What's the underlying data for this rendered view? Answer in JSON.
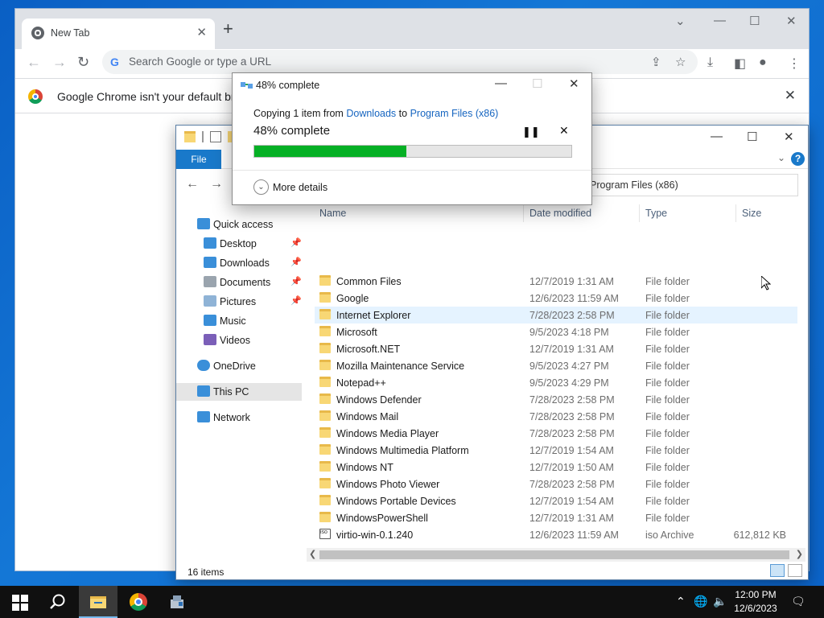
{
  "chrome": {
    "tab_title": "New Tab",
    "tab_close": "✕",
    "new_tab": "+",
    "omnibox_placeholder": "Search Google or type a URL",
    "infobar_text": "Google Chrome isn't your default brow",
    "infobar_close": "✕"
  },
  "copy_dialog": {
    "title": "48% complete",
    "copying_prefix": "Copying 1 item from",
    "source": "Downloads",
    "to_word": "to",
    "destination": "Program Files (x86)",
    "percent_label": "48% complete",
    "progress": 0.48,
    "progress_color": "#06b025",
    "more_details": "More details"
  },
  "explorer": {
    "ribbon_file": "File",
    "address_path": "Program Files (x86)",
    "nav": [
      {
        "label": "Quick access",
        "icon": "star-icon"
      },
      {
        "label": "Desktop",
        "icon": "desktop-icon",
        "pinned": true
      },
      {
        "label": "Downloads",
        "icon": "download-icon",
        "pinned": true
      },
      {
        "label": "Documents",
        "icon": "documents-icon",
        "pinned": true
      },
      {
        "label": "Pictures",
        "icon": "pictures-icon",
        "pinned": true
      },
      {
        "label": "Music",
        "icon": "music-icon"
      },
      {
        "label": "Videos",
        "icon": "videos-icon"
      },
      {
        "label": "OneDrive",
        "icon": "cloud-icon"
      },
      {
        "label": "This PC",
        "icon": "computer-icon",
        "selected": true
      },
      {
        "label": "Network",
        "icon": "network-icon"
      }
    ],
    "columns": {
      "name": "Name",
      "date": "Date modified",
      "type": "Type",
      "size": "Size"
    },
    "files": [
      {
        "name": "Common Files",
        "date": "12/7/2019 1:31 AM",
        "type": "File folder",
        "size": ""
      },
      {
        "name": "Google",
        "date": "12/6/2023 11:59 AM",
        "type": "File folder",
        "size": ""
      },
      {
        "name": "Internet Explorer",
        "date": "7/28/2023 2:58 PM",
        "type": "File folder",
        "size": ""
      },
      {
        "name": "Microsoft",
        "date": "9/5/2023 4:18 PM",
        "type": "File folder",
        "size": ""
      },
      {
        "name": "Microsoft.NET",
        "date": "12/7/2019 1:31 AM",
        "type": "File folder",
        "size": ""
      },
      {
        "name": "Mozilla Maintenance Service",
        "date": "9/5/2023 4:27 PM",
        "type": "File folder",
        "size": ""
      },
      {
        "name": "Notepad++",
        "date": "9/5/2023 4:29 PM",
        "type": "File folder",
        "size": ""
      },
      {
        "name": "Windows Defender",
        "date": "7/28/2023 2:58 PM",
        "type": "File folder",
        "size": ""
      },
      {
        "name": "Windows Mail",
        "date": "7/28/2023 2:58 PM",
        "type": "File folder",
        "size": ""
      },
      {
        "name": "Windows Media Player",
        "date": "7/28/2023 2:58 PM",
        "type": "File folder",
        "size": ""
      },
      {
        "name": "Windows Multimedia Platform",
        "date": "12/7/2019 1:54 AM",
        "type": "File folder",
        "size": ""
      },
      {
        "name": "Windows NT",
        "date": "12/7/2019 1:50 AM",
        "type": "File folder",
        "size": ""
      },
      {
        "name": "Windows Photo Viewer",
        "date": "7/28/2023 2:58 PM",
        "type": "File folder",
        "size": ""
      },
      {
        "name": "Windows Portable Devices",
        "date": "12/7/2019 1:54 AM",
        "type": "File folder",
        "size": ""
      },
      {
        "name": "WindowsPowerShell",
        "date": "12/7/2019 1:31 AM",
        "type": "File folder",
        "size": ""
      },
      {
        "name": "virtio-win-0.1.240",
        "date": "12/6/2023 11:59 AM",
        "type": "iso Archive",
        "size": "612,812 KB"
      }
    ],
    "hover_row": "Internet Explorer",
    "status_count": "16 items"
  },
  "taskbar": {
    "time": "12:00 PM",
    "date": "12/6/2023",
    "active_app": "file-explorer"
  }
}
